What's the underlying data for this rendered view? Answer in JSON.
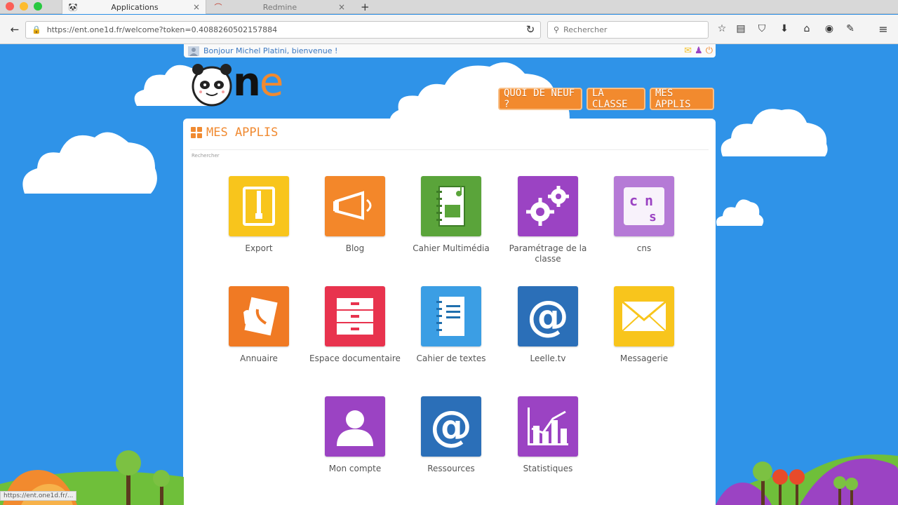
{
  "browser": {
    "tabs": [
      {
        "title": "Applications",
        "active": true
      },
      {
        "title": "Redmine",
        "active": false
      }
    ],
    "url": "https://ent.one1d.fr/welcome?token=0.4088260502157884",
    "search_placeholder": "Rechercher"
  },
  "userbar": {
    "greeting": "Bonjour Michel Platini, bienvenue !"
  },
  "logo": {
    "text": "ne"
  },
  "topnav": {
    "items": [
      "QUOI DE NEUF ?",
      "LA CLASSE",
      "MES APPLIS"
    ]
  },
  "panel": {
    "title": "MES APPLIS",
    "search_label": "Rechercher"
  },
  "apps": [
    {
      "label": "Export",
      "icon": "zip-file-icon",
      "color": "#f8c51c"
    },
    {
      "label": "Blog",
      "icon": "megaphone-icon",
      "color": "#f3872a"
    },
    {
      "label": "Cahier Multimédia",
      "icon": "multimedia-notebook-icon",
      "color": "#5aa43a"
    },
    {
      "label": "Paramétrage de la classe",
      "icon": "gears-icon",
      "color": "#9b43c3"
    },
    {
      "label": "cns",
      "icon": "cns-icon",
      "color": "#b57ad6"
    },
    {
      "label": "Annuaire",
      "icon": "phone-book-icon",
      "color": "#f07a24"
    },
    {
      "label": "Espace documentaire",
      "icon": "drawers-icon",
      "color": "#e8334e"
    },
    {
      "label": "Cahier de textes",
      "icon": "text-notebook-icon",
      "color": "#3b9ee4"
    },
    {
      "label": "Leelle.tv",
      "icon": "at-icon",
      "color": "#2b6fb8"
    },
    {
      "label": "Messagerie",
      "icon": "envelope-icon",
      "color": "#f8c51c"
    },
    {
      "label": "Mon compte",
      "icon": "user-icon",
      "color": "#9b43c3"
    },
    {
      "label": "Ressources",
      "icon": "at-icon",
      "color": "#2b6fb8"
    },
    {
      "label": "Statistiques",
      "icon": "bar-chart-icon",
      "color": "#9b43c3"
    }
  ],
  "status": {
    "text": "https://ent.one1d.fr/..."
  }
}
